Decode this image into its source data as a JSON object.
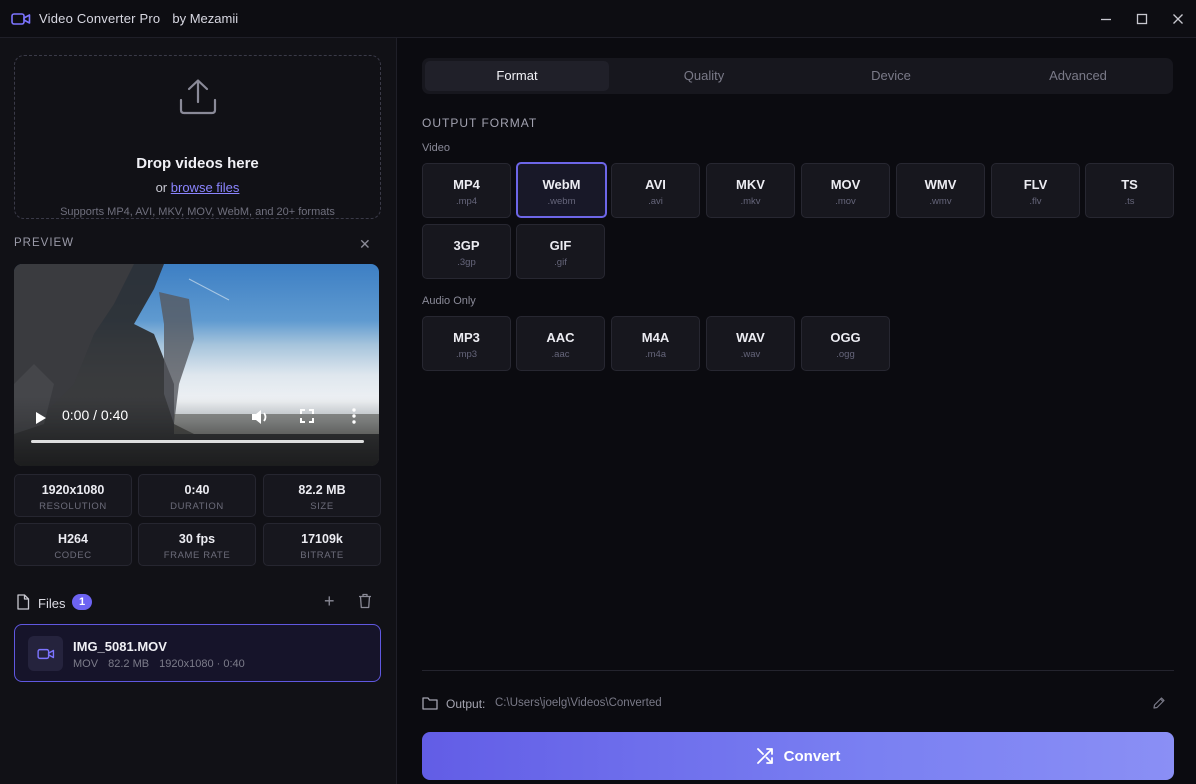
{
  "titlebar": {
    "title": "Video Converter Pro",
    "by": "by Mezamii"
  },
  "dropzone": {
    "title": "Drop videos here",
    "or": "or",
    "browse": "browse files",
    "hint": "Supports MP4, AVI, MKV, MOV, WebM, and 20+ formats"
  },
  "preview": {
    "label": "PREVIEW",
    "time": "0:00 / 0:40",
    "progress": 0
  },
  "stats": [
    {
      "value": "1920x1080",
      "key": "RESOLUTION"
    },
    {
      "value": "0:40",
      "key": "DURATION"
    },
    {
      "value": "82.2 MB",
      "key": "SIZE"
    },
    {
      "value": "H264",
      "key": "CODEC"
    },
    {
      "value": "30 fps",
      "key": "FRAME RATE"
    },
    {
      "value": "17109k",
      "key": "BITRATE"
    }
  ],
  "files": {
    "label": "Files",
    "count": "1",
    "items": [
      {
        "name": "IMG_5081.MOV",
        "type": "MOV",
        "size": "82.2 MB",
        "details": "1920x1080 · 0:40"
      }
    ]
  },
  "tabs": [
    "Format",
    "Quality",
    "Device",
    "Advanced"
  ],
  "active_tab": "Format",
  "output_format_label": "OUTPUT FORMAT",
  "video_label": "Video",
  "audio_label": "Audio Only",
  "video_formats": [
    {
      "name": "MP4",
      "ext": ".mp4"
    },
    {
      "name": "WebM",
      "ext": ".webm"
    },
    {
      "name": "AVI",
      "ext": ".avi"
    },
    {
      "name": "MKV",
      "ext": ".mkv"
    },
    {
      "name": "MOV",
      "ext": ".mov"
    },
    {
      "name": "WMV",
      "ext": ".wmv"
    },
    {
      "name": "FLV",
      "ext": ".flv"
    },
    {
      "name": "TS",
      "ext": ".ts"
    },
    {
      "name": "3GP",
      "ext": ".3gp"
    },
    {
      "name": "GIF",
      "ext": ".gif"
    }
  ],
  "audio_formats": [
    {
      "name": "MP3",
      "ext": ".mp3"
    },
    {
      "name": "AAC",
      "ext": ".aac"
    },
    {
      "name": "M4A",
      "ext": ".m4a"
    },
    {
      "name": "WAV",
      "ext": ".wav"
    },
    {
      "name": "OGG",
      "ext": ".ogg"
    }
  ],
  "selected_format": "WebM",
  "output": {
    "label": "Output:",
    "path": "C:\\Users\\joelg\\Videos\\Converted"
  },
  "convert_label": "Convert",
  "colors": {
    "accent": "#6d63f2",
    "background": "#0b0b10",
    "panel": "#111116"
  },
  "icons": {
    "app": "video-camera-icon",
    "upload": "upload-icon",
    "file": "file-icon",
    "folder": "folder-icon",
    "edit": "pencil-icon",
    "convert": "shuffle-icon"
  }
}
